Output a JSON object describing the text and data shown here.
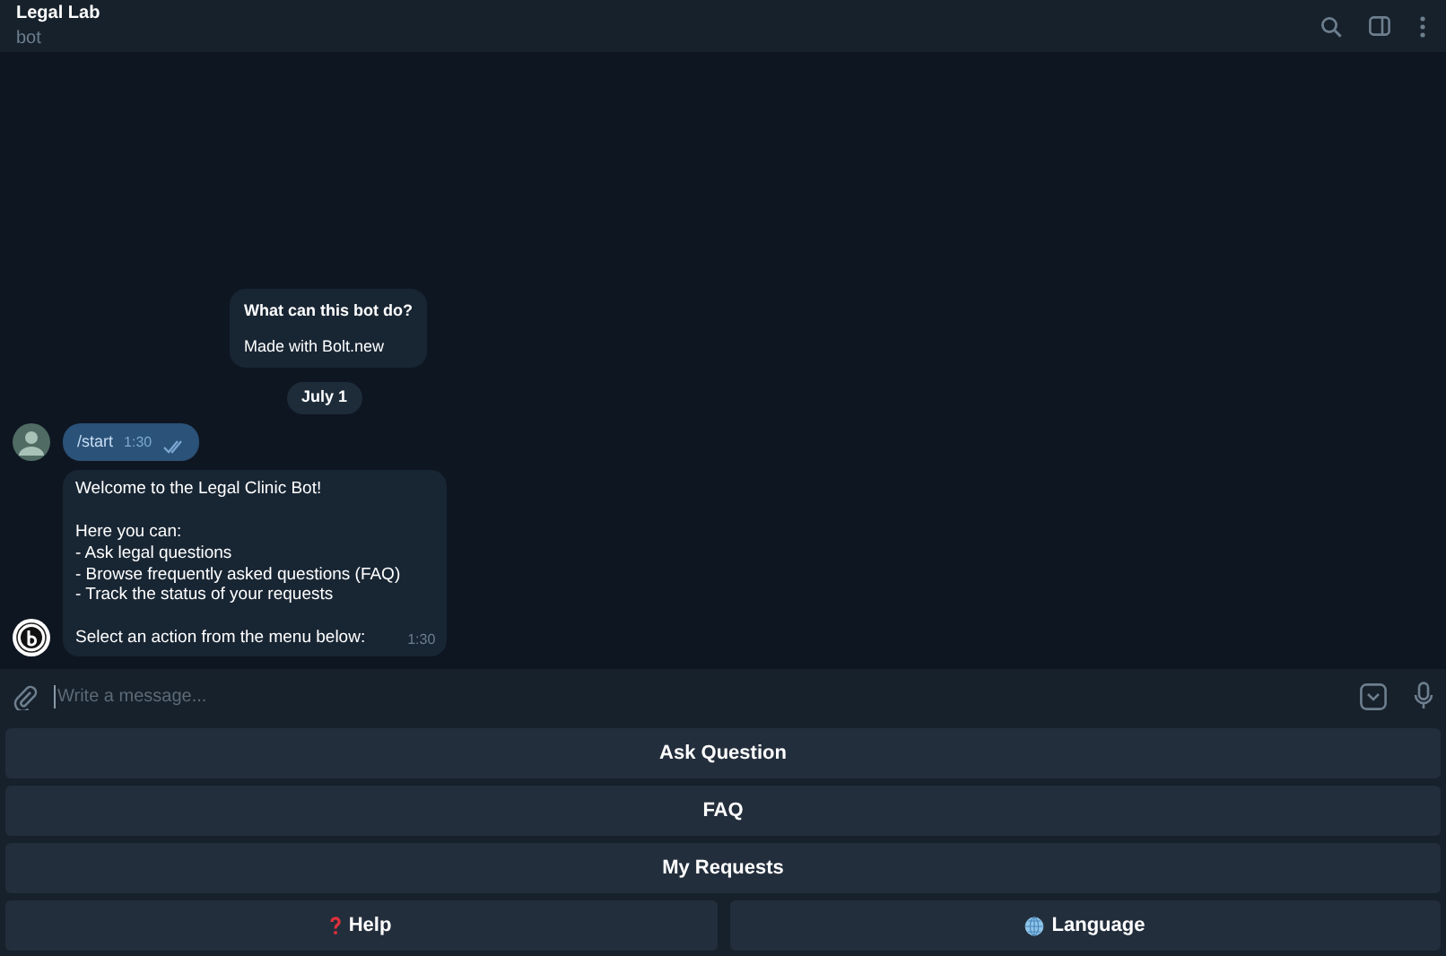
{
  "header": {
    "title": "Legal Lab",
    "subtitle": "bot"
  },
  "messages": [
    {
      "kind": "info",
      "title": "What can this bot do?",
      "text": "Made with Bolt.new"
    },
    {
      "kind": "date",
      "text": "July 1"
    },
    {
      "kind": "outgoing",
      "text": "/start",
      "time": "1:30",
      "read": true
    },
    {
      "kind": "incoming",
      "paragraphs": [
        [
          "Welcome to the Legal Clinic Bot!"
        ],
        [
          "Here you can:",
          "- Ask legal questions",
          "- Browse frequently asked questions (FAQ)",
          "- Track the status of your requests"
        ],
        [
          "Select an action from the menu below:"
        ]
      ],
      "time": "1:30"
    }
  ],
  "composer": {
    "placeholder": "Write a message..."
  },
  "keyboard": [
    [
      {
        "label": "Ask Question"
      }
    ],
    [
      {
        "label": "FAQ"
      }
    ],
    [
      {
        "label": "My Requests"
      }
    ],
    [
      {
        "label": "Help"
      },
      {
        "label": "Language"
      }
    ]
  ]
}
